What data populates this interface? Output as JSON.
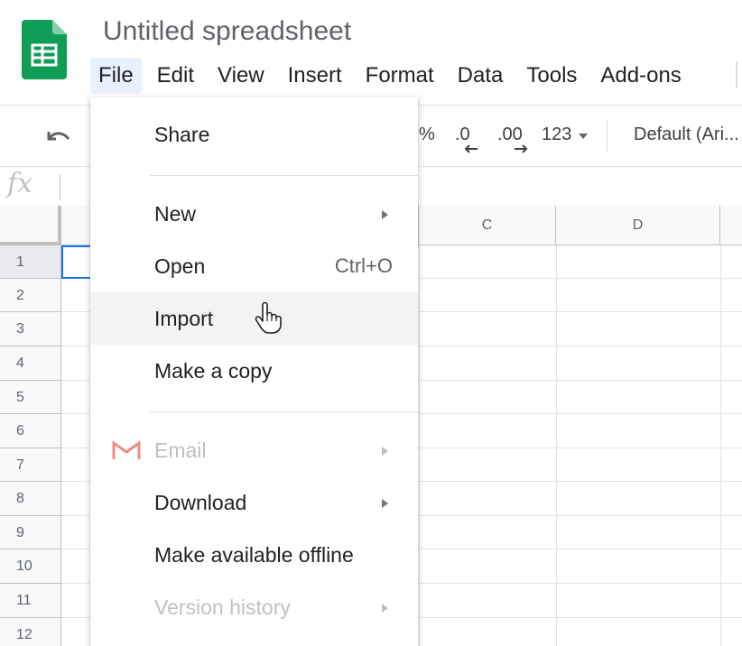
{
  "app": {
    "title": "Untitled spreadsheet",
    "logo_icon": "google-sheets-icon",
    "colors": {
      "brand": "#0f9d58",
      "accent": "#1a73e8",
      "active_menu_bg": "#e8f0fe"
    }
  },
  "menubar": {
    "items": [
      "File",
      "Edit",
      "View",
      "Insert",
      "Format",
      "Data",
      "Tools",
      "Add-ons"
    ],
    "active": "File"
  },
  "toolbar": {
    "undo_icon": "undo-icon",
    "percent": "%",
    "decrease_decimal": ".0",
    "increase_decimal": ".00",
    "more_formats": "123",
    "font": "Default (Ari..."
  },
  "formula_bar": {
    "fx": "fx"
  },
  "grid": {
    "columns": [
      "C",
      "D"
    ],
    "rows": [
      "1",
      "2",
      "3",
      "4",
      "5",
      "6",
      "7",
      "8",
      "9",
      "10",
      "11",
      "12"
    ]
  },
  "file_menu": {
    "share": "Share",
    "new": "New",
    "open": "Open",
    "open_shortcut": "Ctrl+O",
    "import": "Import",
    "make_copy": "Make a copy",
    "email": "Email",
    "download": "Download",
    "offline": "Make available offline",
    "version_history": "Version history"
  }
}
